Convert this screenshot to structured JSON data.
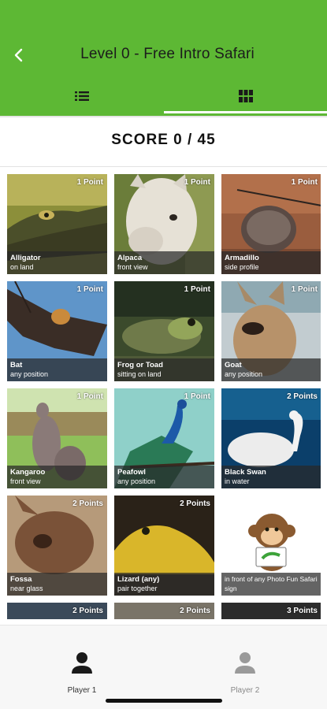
{
  "header": {
    "title": "Level 0 - Free Intro Safari",
    "tabs": [
      "list-view",
      "grid-view"
    ],
    "colors": {
      "appbar": "#5db834"
    }
  },
  "score": {
    "text": "SCORE 0 / 45"
  },
  "cards": [
    {
      "name": "Alligator",
      "desc": "on land",
      "points": "1 Point"
    },
    {
      "name": "Alpaca",
      "desc": "front view",
      "points": "1 Point"
    },
    {
      "name": "Armadillo",
      "desc": "side profile",
      "points": "1 Point"
    },
    {
      "name": "Bat",
      "desc": "any position",
      "points": "1 Point"
    },
    {
      "name": "Frog or Toad",
      "desc": "sitting on land",
      "points": "1 Point"
    },
    {
      "name": "Goat",
      "desc": "any position",
      "points": "1 Point"
    },
    {
      "name": "Kangaroo",
      "desc": "front view",
      "points": "1 Point"
    },
    {
      "name": "Peafowl",
      "desc": "any position",
      "points": "1 Point"
    },
    {
      "name": "Black Swan",
      "desc": "in water",
      "points": "2 Points"
    },
    {
      "name": "Fossa",
      "desc": "near glass",
      "points": "2 Points"
    },
    {
      "name": "Lizard (any)",
      "desc": "pair together",
      "points": "2 Points"
    },
    {
      "name": "",
      "desc": "in front of any Photo Fun Safari sign",
      "points": ""
    },
    {
      "name": "",
      "desc": "",
      "points": "2 Points"
    },
    {
      "name": "",
      "desc": "",
      "points": "2 Points"
    },
    {
      "name": "",
      "desc": "",
      "points": "3 Points"
    }
  ],
  "bottom_nav": {
    "player1": "Player 1",
    "player2": "Player 2"
  }
}
